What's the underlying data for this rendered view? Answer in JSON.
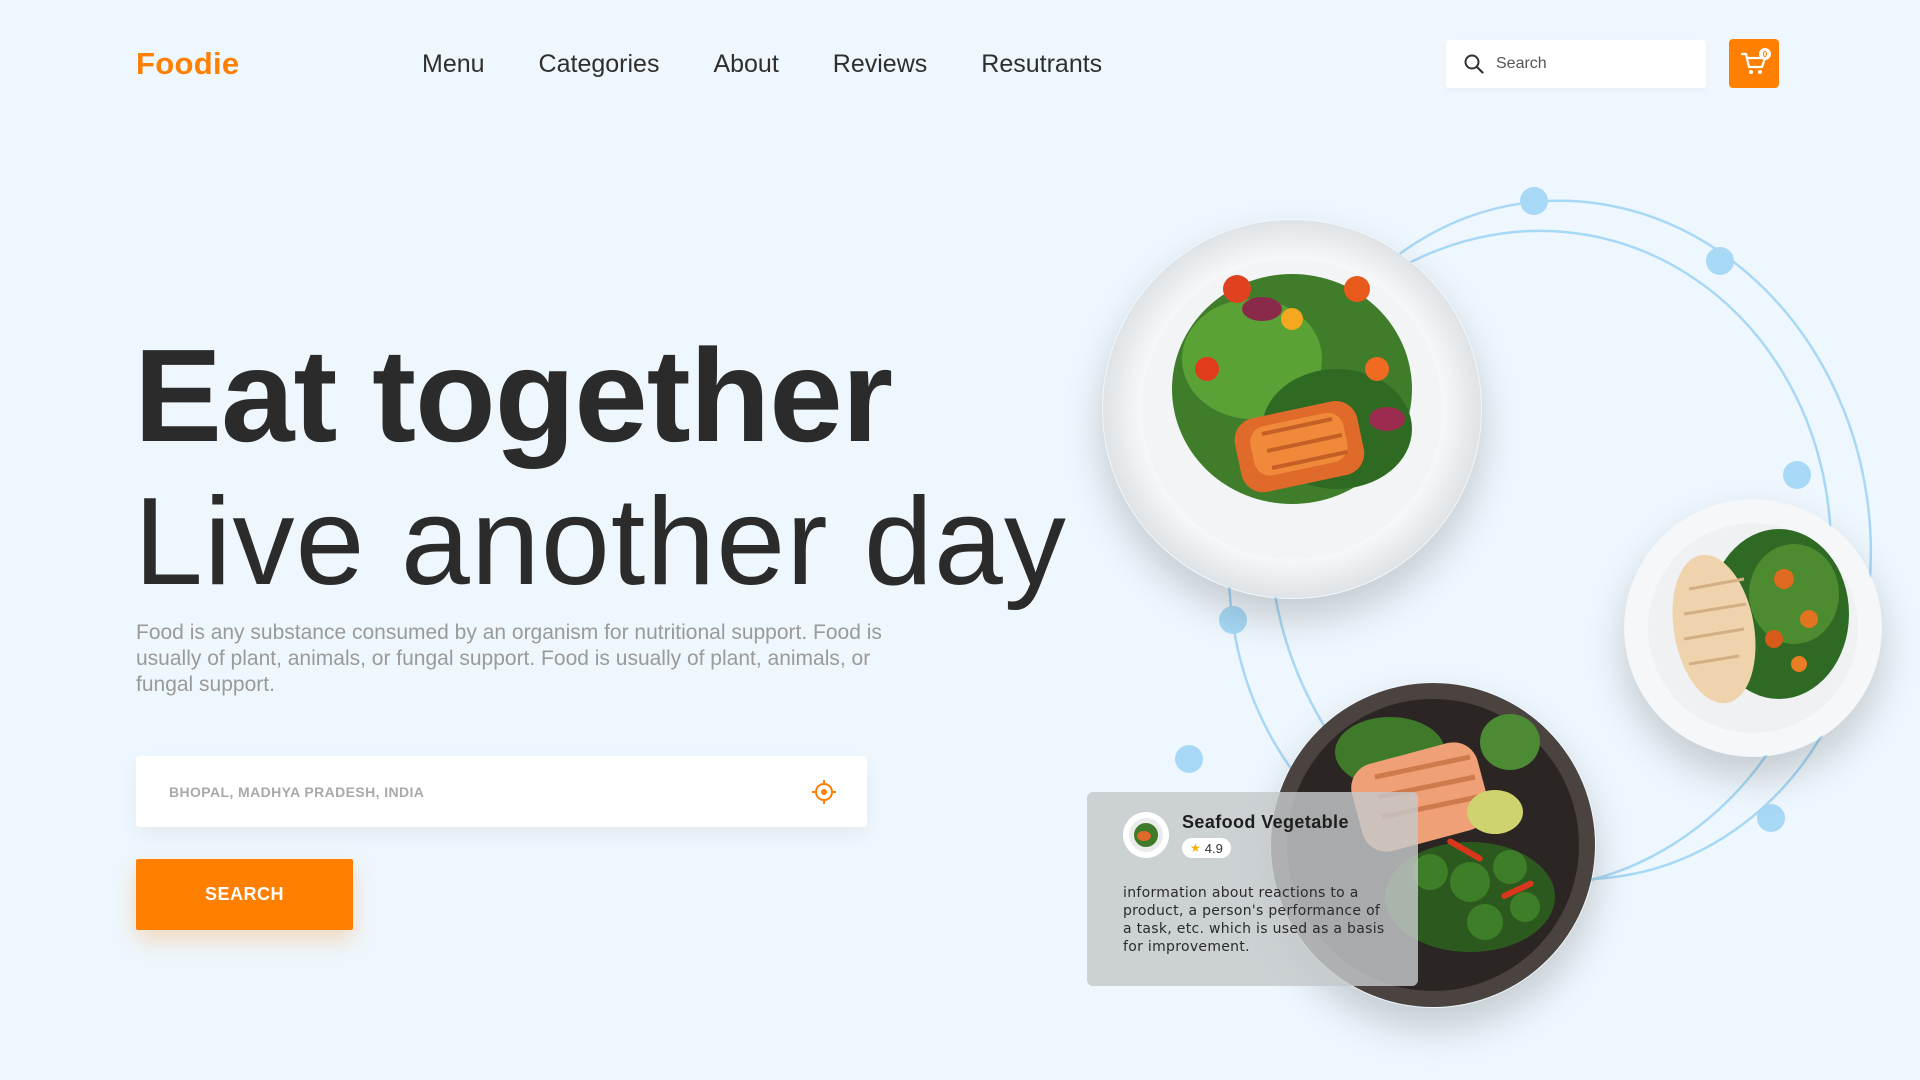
{
  "header": {
    "logo": "Foodie",
    "nav": [
      "Menu",
      "Categories",
      "About",
      "Reviews",
      "Resutrants"
    ],
    "search_placeholder": "Search",
    "cart_count": "0"
  },
  "hero": {
    "title_line1": "Eat together",
    "title_line2": "Live another day",
    "description": "Food is any substance consumed by an organism for nutritional support. Food is usually of plant, animals, or fungal support. Food is usually of plant, animals, or fungal support.",
    "location_value": "BHOPAL, MADHYA PRADESH, INDIA",
    "search_button": "SEARCH"
  },
  "card": {
    "title": "Seafood Vegetable",
    "rating": "4.9",
    "text": "information about reactions to a product, a person's performance of a task, etc. which is used as a basis for improvement."
  },
  "colors": {
    "accent": "#ff7f00",
    "background": "#eef7fd",
    "orbit": "#a7d8f5"
  },
  "icons": {
    "search": "search-icon",
    "cart": "cart-icon",
    "locate": "crosshair-icon",
    "star": "star-icon"
  }
}
